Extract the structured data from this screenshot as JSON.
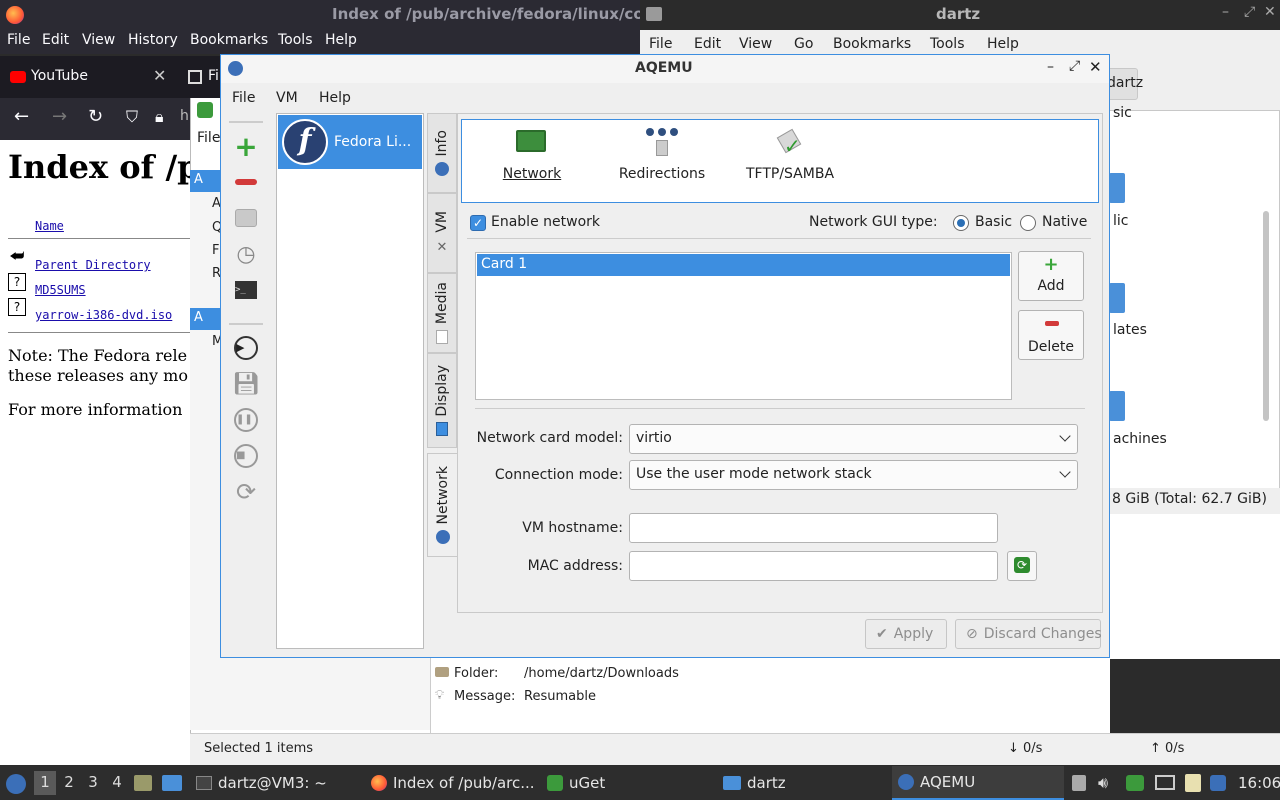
{
  "firefox": {
    "window_title": "Index of /pub/archive/fedora/linux/core",
    "menu": [
      "File",
      "Edit",
      "View",
      "History",
      "Bookmarks",
      "Tools",
      "Help"
    ],
    "tab_youtube": "YouTube",
    "tab2_partial": "Fi",
    "url_partial": "h",
    "page": {
      "heading": "Index of /p",
      "col_name": "Name",
      "entries": [
        "Parent Directory",
        "MD5SUMS",
        "yarrow-i386-dvd.iso"
      ],
      "note_line1": "Note: The Fedora rele",
      "note_line2": "these releases any mo",
      "more_info": "For more information"
    }
  },
  "uget": {
    "file_menu": "File",
    "side_items": [
      "A",
      "A",
      "Q",
      "F",
      "R",
      "A",
      "M"
    ],
    "folder_label": "Folder:",
    "folder_value": "/home/dartz/Downloads",
    "message_label": "Message:",
    "message_value": "Resumable",
    "status_selected": "Selected 1 items",
    "down_speed": "↓ 0/s",
    "up_speed": "↑ 0/s"
  },
  "thunar": {
    "window_title": "dartz",
    "menu": [
      "File",
      "Edit",
      "View",
      "Go",
      "Bookmarks",
      "Tools",
      "Help"
    ],
    "path_button": "dartz",
    "items_partial": [
      "sic",
      "lic",
      "lates",
      "achines"
    ],
    "status_partial": "8 GiB (Total: 62.7 GiB)"
  },
  "aqemu": {
    "title": "AQEMU",
    "menu": [
      "File",
      "VM",
      "Help"
    ],
    "vm_name": "Fedora Li...",
    "tabs": [
      "Info",
      "VM",
      "Media",
      "Display",
      "Network"
    ],
    "subtabs": [
      "Network",
      "Redirections",
      "TFTP/SAMBA"
    ],
    "enable_network_label": "Enable network",
    "gui_type_label": "Network GUI type:",
    "gui_type_basic": "Basic",
    "gui_type_native": "Native",
    "cards": [
      "Card 1"
    ],
    "add_label": "Add",
    "delete_label": "Delete",
    "card_model_label": "Network card model:",
    "card_model_value": "virtio",
    "connection_mode_label": "Connection mode:",
    "connection_mode_value": "Use the user mode network stack",
    "hostname_label": "VM hostname:",
    "hostname_value": "",
    "mac_label": "MAC address:",
    "mac_value": "",
    "apply_label": "Apply",
    "discard_label": "Discard Changes"
  },
  "taskbar": {
    "workspaces": [
      "1",
      "2",
      "3",
      "4"
    ],
    "tasks": [
      "dartz@VM3: ~",
      "Index of /pub/arc...",
      "uGet",
      "dartz",
      "AQEMU"
    ],
    "clock": "16:06"
  },
  "colors": {
    "accent": "#3d8ee0",
    "dark_chrome": "#2b2a33",
    "add_green": "#3aa63a",
    "delete_red": "#d23a3a"
  }
}
